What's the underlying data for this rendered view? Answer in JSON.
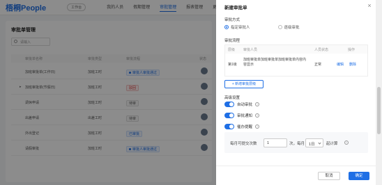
{
  "app": {
    "logo": "梧桐People",
    "badge": "工作台",
    "nav": [
      "我的人员",
      "假期管理",
      "审批管理",
      "报表管理",
      "更多"
    ]
  },
  "page": {
    "title": "审批单管理",
    "search_placeholder": "请输入",
    "columns": [
      "审批单名称",
      "审批类型",
      "审批流程",
      "状态"
    ],
    "rows": [
      {
        "name": "加班审批单(工作日)",
        "type": "加班工时",
        "flow": "审批人审批通过",
        "tag_style": "blue"
      },
      {
        "name": "加班审批单(节假日)",
        "type": "加班工时",
        "flow": "驳回",
        "tag_style": "red"
      },
      {
        "name": "调休申请",
        "type": "加班工时",
        "flow": "待审",
        "tag_style": "grey"
      },
      {
        "name": "出差申请",
        "type": "出差工时",
        "flow": "待审",
        "tag_style": "grey"
      },
      {
        "name": "外出登记",
        "type": "加班工时",
        "flow": "已审批",
        "tag_style": "blue"
      },
      {
        "name": "请假审批",
        "type": "加班工时",
        "flow": "审批人审批通过",
        "tag_style": "blue"
      }
    ]
  },
  "drawer": {
    "title": "新建审批单",
    "mode_label": "审批方式",
    "mode_options": [
      {
        "label": "指定审批人",
        "selected": true
      },
      {
        "label": "逐级审批",
        "selected": false
      }
    ],
    "flow_label": "审批流程",
    "table_headers": [
      "层级",
      "审批人员",
      "人员状态",
      "操作"
    ],
    "table_row": {
      "level": "第1级",
      "approvers": "加班审批单加班审批单加班审批单内容内容显示",
      "status": "正常",
      "edit": "编辑",
      "delete": "删除"
    },
    "add_button": "+ 新增审批层级",
    "settings_label": "高级设置",
    "toggles": [
      {
        "label": "自动审批",
        "info": true,
        "on": true
      },
      {
        "label": "审批通知",
        "info": true,
        "on": true
      },
      {
        "label": "催办提醒",
        "info": true,
        "on": true
      }
    ],
    "limit": {
      "prefix": "每月可提交次数",
      "value": "1",
      "mid": "次，每月",
      "select": "1日",
      "suffix": "起计算"
    },
    "cancel": "取消",
    "ok": "确定"
  },
  "colors": {
    "primary": "#1f6fe5",
    "overlay": "rgba(0,0,0,0.45)"
  }
}
